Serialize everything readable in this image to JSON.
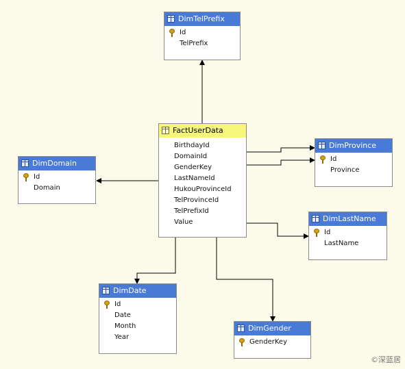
{
  "colors": {
    "background": "#fcfbe9",
    "dimension_header": "#4a7ad8",
    "fact_header": "#f6f57c",
    "key": "#d4a017"
  },
  "tables": {
    "dim_tel_prefix": {
      "title": "DimTelPrefix",
      "columns": [
        {
          "name": "Id",
          "key": true
        },
        {
          "name": "TelPrefix",
          "key": false
        }
      ]
    },
    "fact_user_data": {
      "title": "FactUserData",
      "columns": [
        {
          "name": "BirthdayId",
          "key": false
        },
        {
          "name": "DomainId",
          "key": false
        },
        {
          "name": "GenderKey",
          "key": false
        },
        {
          "name": "LastNameId",
          "key": false
        },
        {
          "name": "HukouProvinceId",
          "key": false
        },
        {
          "name": "TelProvinceId",
          "key": false
        },
        {
          "name": "TelPrefixId",
          "key": false
        },
        {
          "name": "Value",
          "key": false
        }
      ]
    },
    "dim_domain": {
      "title": "DimDomain",
      "columns": [
        {
          "name": "Id",
          "key": true
        },
        {
          "name": "Domain",
          "key": false
        }
      ]
    },
    "dim_province": {
      "title": "DimProvince",
      "columns": [
        {
          "name": "Id",
          "key": true
        },
        {
          "name": "Province",
          "key": false
        }
      ]
    },
    "dim_last_name": {
      "title": "DimLastName",
      "columns": [
        {
          "name": "Id",
          "key": true
        },
        {
          "name": "LastName",
          "key": false
        }
      ]
    },
    "dim_date": {
      "title": "DimDate",
      "columns": [
        {
          "name": "Id",
          "key": true
        },
        {
          "name": "Date",
          "key": false
        },
        {
          "name": "Month",
          "key": false
        },
        {
          "name": "Year",
          "key": false
        }
      ]
    },
    "dim_gender": {
      "title": "DimGender",
      "columns": [
        {
          "name": "GenderKey",
          "key": true
        }
      ]
    }
  },
  "relationships": [
    {
      "from": "fact_user_data",
      "to": "dim_tel_prefix"
    },
    {
      "from": "fact_user_data",
      "to": "dim_domain"
    },
    {
      "from": "fact_user_data",
      "to": "dim_province"
    },
    {
      "from": "fact_user_data",
      "to": "dim_province"
    },
    {
      "from": "fact_user_data",
      "to": "dim_last_name"
    },
    {
      "from": "fact_user_data",
      "to": "dim_date"
    },
    {
      "from": "fact_user_data",
      "to": "dim_gender"
    }
  ],
  "watermark": "©深蓝居"
}
